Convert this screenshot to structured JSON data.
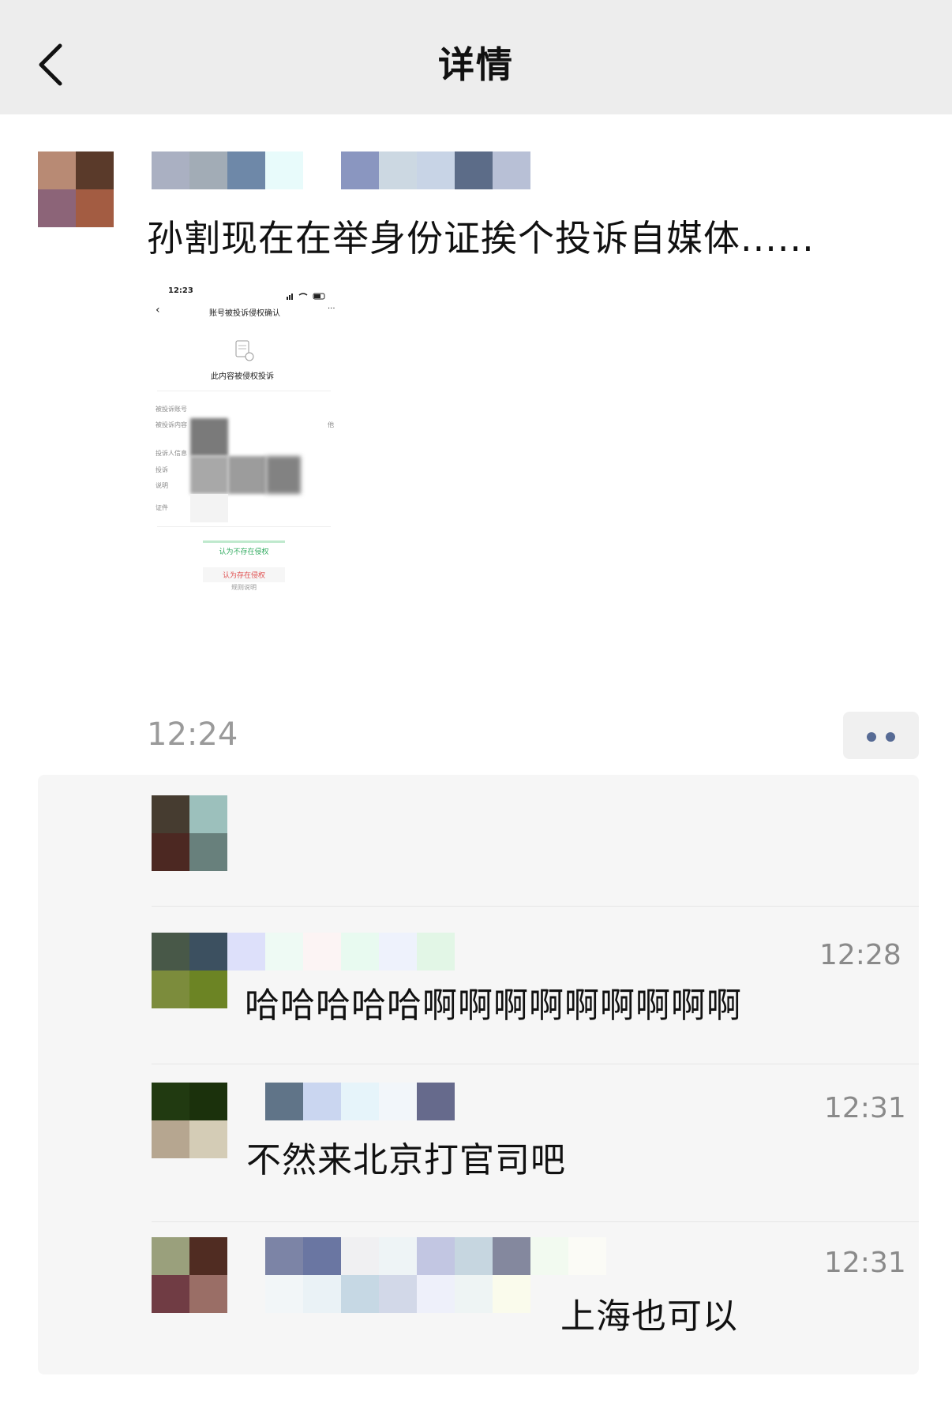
{
  "nav": {
    "title": "详情",
    "back_icon": "chevron-left-icon"
  },
  "post": {
    "text": "孙割现在在举身份证挨个投诉自媒体......",
    "time": "12:24",
    "screenshot": {
      "status_time": "12:23",
      "title": "账号被投诉侵权确认",
      "menu": "···",
      "heading": "此内容被侵权投诉",
      "rows": [
        "被投诉账号",
        "被投诉内容",
        "投诉人信息",
        "投诉",
        "说明",
        "证件"
      ],
      "row_value": "他",
      "btn_no_infringe": "认为不存在侵权",
      "btn_infringe": "认为存在侵权",
      "rules": "规则说明"
    }
  },
  "comments": [
    {
      "time": "",
      "text": ""
    },
    {
      "time": "12:28",
      "text": "哈哈哈哈哈啊啊啊啊啊啊啊啊啊"
    },
    {
      "time": "12:31",
      "text": "不然来北京打官司吧"
    },
    {
      "time": "12:31",
      "text": "上海也可以"
    }
  ],
  "colors": {
    "link_blue": "#576b95",
    "nav_bg": "#ededed",
    "panel_bg": "#f6f6f6"
  }
}
